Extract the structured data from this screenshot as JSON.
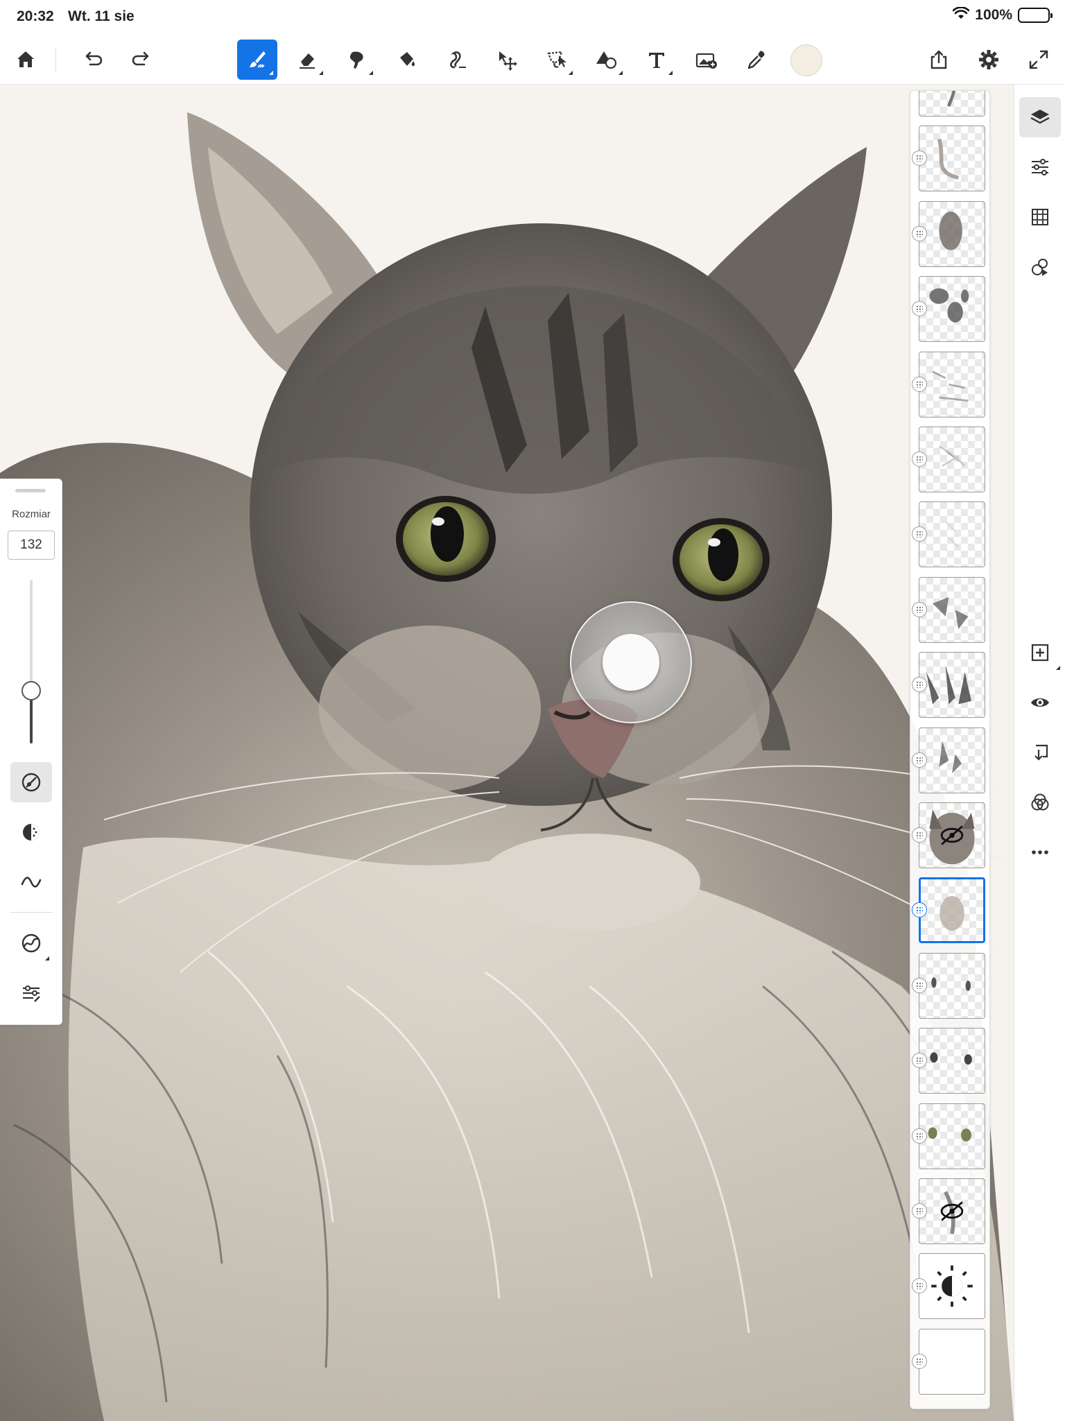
{
  "status_bar": {
    "time": "20:32",
    "date": "Wt. 11 sie",
    "battery": "100%",
    "battery_level": 1.0
  },
  "toolbar": {
    "left_icons": [
      "home-icon",
      "undo-icon",
      "redo-icon"
    ],
    "tools": [
      "paint-brush-icon",
      "eraser-icon",
      "smudge-icon",
      "fill-bucket-icon",
      "liquify-icon",
      "move-transform-icon",
      "lasso-select-icon",
      "shape-icon",
      "text-icon",
      "add-image-icon",
      "eyedropper-icon"
    ],
    "active_tool": "paint-brush-icon",
    "color_swatch": "#f3ede2",
    "right_icons": [
      "share-icon",
      "settings-icon",
      "fullscreen-icon"
    ],
    "accent": "#1473e6"
  },
  "brush_panel": {
    "size_label": "Rozmiar",
    "size_value": "132",
    "size_slider_level": 0.32,
    "icons": [
      "brush-settings-icon",
      "opacity-icon",
      "pressure-icon",
      "brush-type-icon",
      "brush-adjust-icon"
    ]
  },
  "layers_panel": {
    "layer_count": 18,
    "selected_index": 11,
    "hidden_layer_indices": [
      10,
      15
    ],
    "adjustment_layer_icon": "brightness-icon"
  },
  "right_panel": {
    "top_icons": [
      "layers-icon",
      "adjustments-icon",
      "grid-icon",
      "blend-effects-icon"
    ],
    "bottom_icons": [
      "add-layer-icon",
      "visibility-icon",
      "merge-down-icon",
      "blend-mode-icon",
      "more-icon"
    ]
  }
}
